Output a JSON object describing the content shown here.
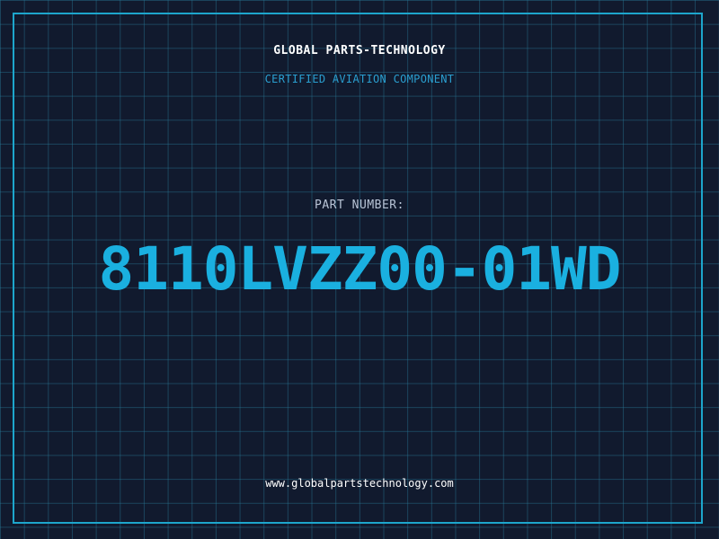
{
  "header": {
    "company": "GLOBAL PARTS-TECHNOLOGY",
    "subtitle": "CERTIFIED AVIATION COMPONENT"
  },
  "part": {
    "label": "PART NUMBER:",
    "number": "8110LVZZ00-01WD"
  },
  "footer": {
    "website": "www.globalpartstechnology.com"
  },
  "colors": {
    "background": "#111a2e",
    "grid": "#287896",
    "frame": "#1da6cc",
    "accent": "#1ab0e0"
  }
}
